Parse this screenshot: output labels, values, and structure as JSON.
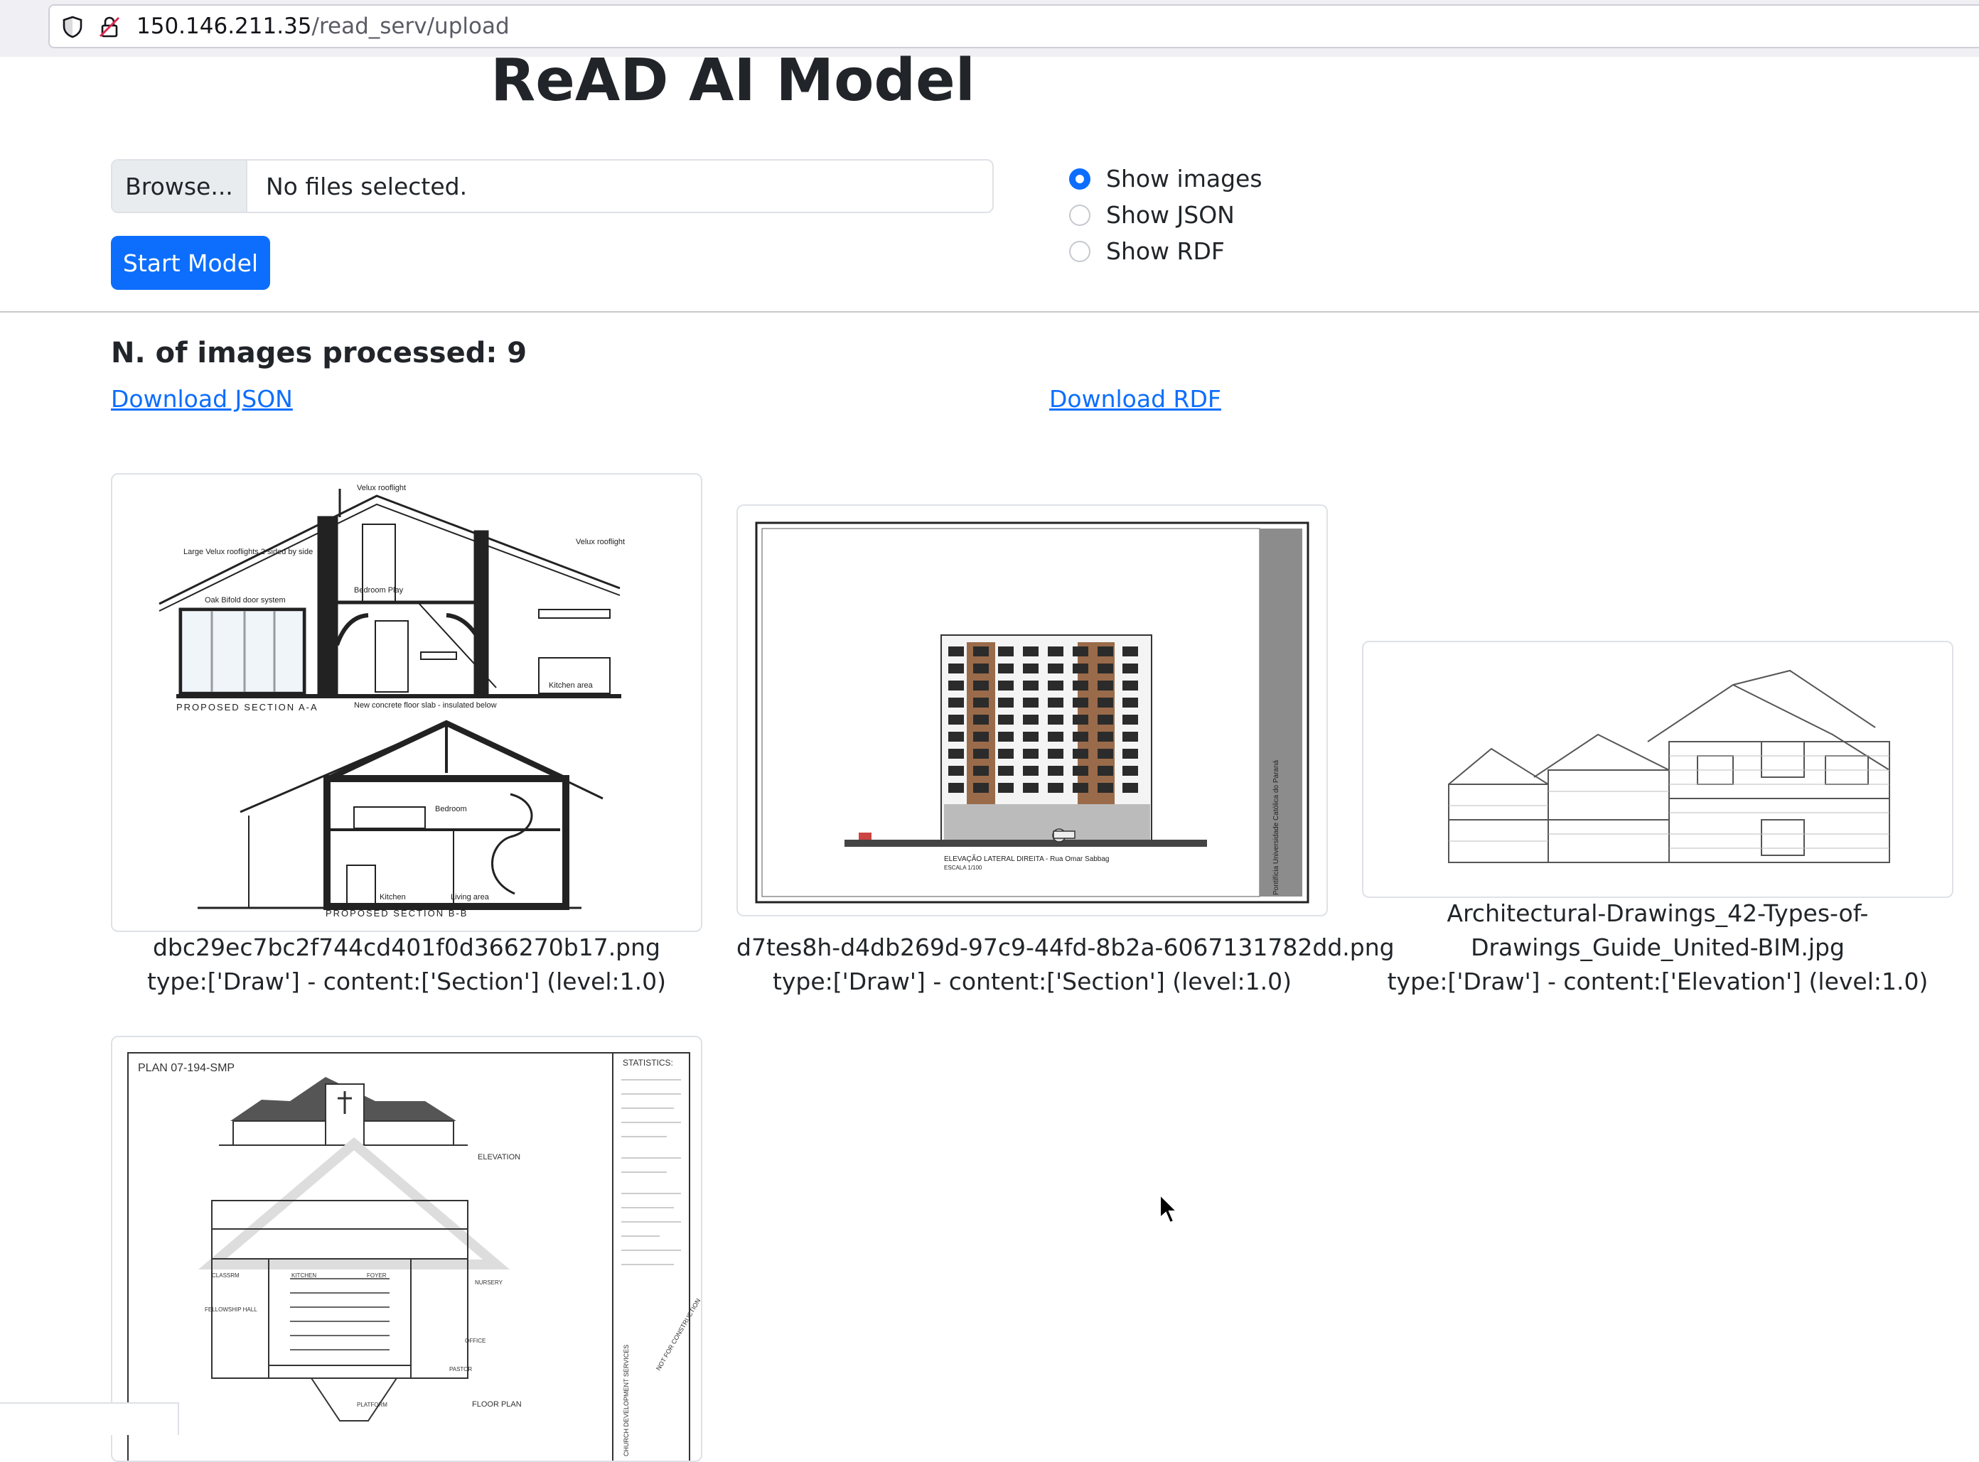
{
  "browser": {
    "url_host": "150.146.211.35",
    "url_path": "/read_serv/upload"
  },
  "page": {
    "title": "ReAD AI Model"
  },
  "upload": {
    "browse_label": "Browse...",
    "status_text": "No files selected.",
    "start_label": "Start Model"
  },
  "view_options": {
    "selected": "Show images",
    "options": [
      {
        "label": "Show images",
        "checked": true
      },
      {
        "label": "Show JSON",
        "checked": false
      },
      {
        "label": "Show RDF",
        "checked": false
      }
    ]
  },
  "results": {
    "count_text": "N. of images processed: 9",
    "download_json": "Download JSON",
    "download_rdf": "Download RDF",
    "items": [
      {
        "filename": "dbc29ec7bc2f744cd401f0d366270b17.png",
        "classification": "type:['Draw'] - content:['Section'] (level:1.0)",
        "drawing_labels": [
          "Velux rooflight",
          "Large Velux rooflights 2 sided by side",
          "Velux rooflight",
          "Oak Bifold door system",
          "Bedroom Play",
          "New concrete floor slab - insulated below",
          "Kitchen area",
          "PROPOSED SECTION A-A",
          "Bedroom",
          "Kitchen",
          "Living area",
          "PROPOSED SECTION B-B"
        ]
      },
      {
        "filename": "d7tes8h-d4db269d-97c9-44fd-8b2a-6067131782dd.png",
        "classification": "type:['Draw'] - content:['Section'] (level:1.0)",
        "drawing_labels": [
          "ELEVAÇÃO LATERAL DIREITA - Rua Omar Sabbag",
          "ESCALA 1/100",
          "Pontifícia Universidade Católica do Paraná"
        ]
      },
      {
        "filename_line1": "Architectural-Drawings_42-Types-of-",
        "filename_line2": "Drawings_Guide_United-BIM.jpg",
        "classification": "type:['Draw'] - content:['Elevation'] (level:1.0)"
      },
      {
        "drawing_labels": [
          "PLAN 07-194-SMP",
          "ELEVATION",
          "STATISTICS:",
          "CLASSRM",
          "KITCHEN",
          "FOYER",
          "NURSERY",
          "FELLOWSHIP HALL",
          "OFFICE",
          "PASTOR",
          "FLOOR PLAN",
          "PLATFORM",
          "NOT FOR CONSTRUCTION",
          "CHURCH DEVELOPMENT SERVICES"
        ]
      }
    ]
  }
}
